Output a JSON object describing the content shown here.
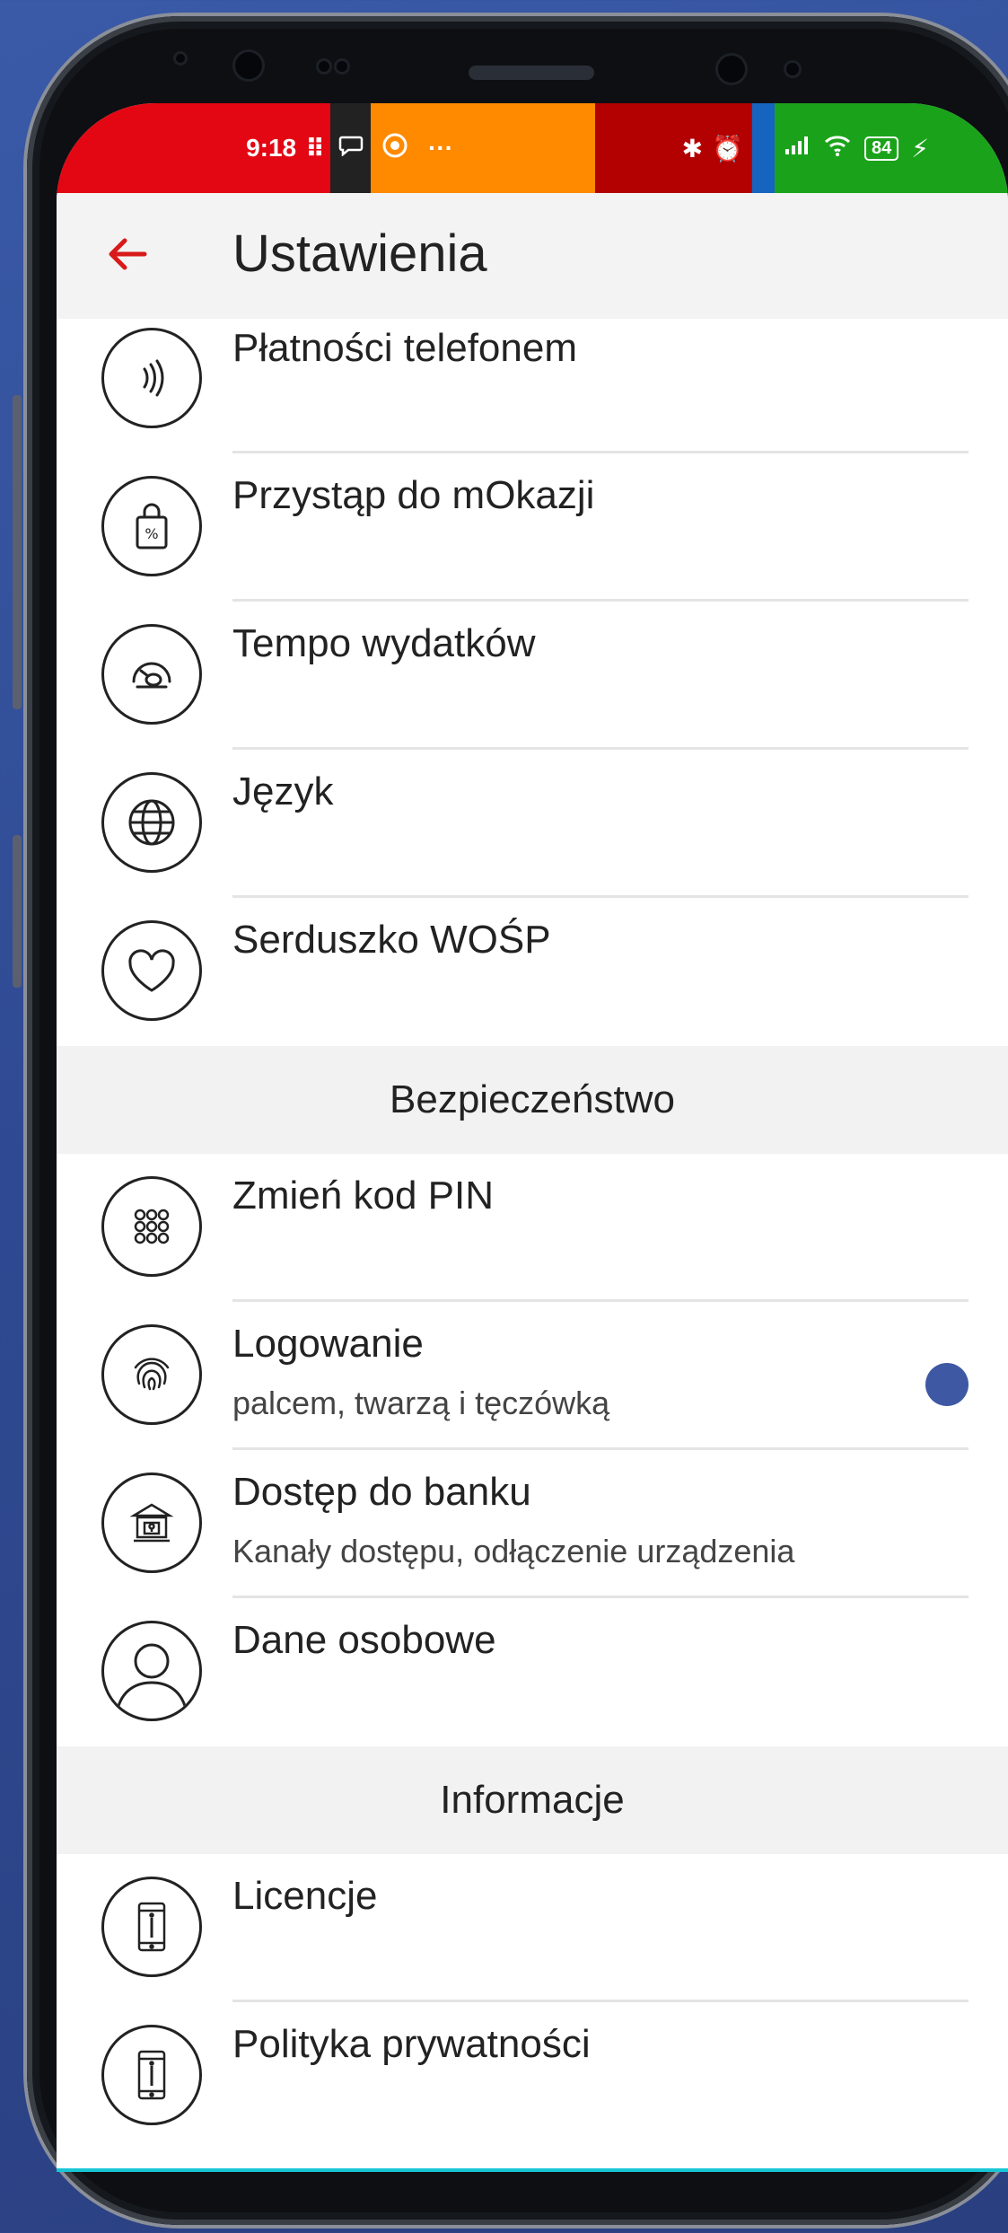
{
  "status_bar": {
    "time": "9:18",
    "battery": "84"
  },
  "header": {
    "title": "Ustawienia"
  },
  "group1": [
    {
      "label": "Płatności telefonem",
      "icon": "nfc-icon"
    },
    {
      "label": "Przystąp do mOkazji",
      "icon": "shopping-bag-percent-icon"
    },
    {
      "label": "Tempo wydatków",
      "icon": "speedometer-icon"
    },
    {
      "label": "Język",
      "icon": "globe-icon"
    },
    {
      "label": "Serduszko WOŚP",
      "icon": "heart-icon"
    }
  ],
  "security": {
    "header": "Bezpieczeństwo",
    "items": [
      {
        "label": "Zmień kod PIN",
        "sub": "",
        "icon": "keypad-icon"
      },
      {
        "label": "Logowanie",
        "sub": "palcem, twarzą i tęczówką",
        "icon": "fingerprint-icon"
      },
      {
        "label": "Dostęp do banku",
        "sub": "Kanały dostępu, odłączenie urządzenia",
        "icon": "bank-lock-icon"
      },
      {
        "label": "Dane osobowe",
        "sub": "",
        "icon": "person-icon"
      }
    ]
  },
  "info": {
    "header": "Informacje",
    "items": [
      {
        "label": "Licencje",
        "icon": "phone-info-icon"
      },
      {
        "label": "Polityka prywatności",
        "icon": "phone-info-icon"
      }
    ]
  },
  "colors": {
    "accent": "#e30613",
    "indicator": "#3e58a4"
  }
}
